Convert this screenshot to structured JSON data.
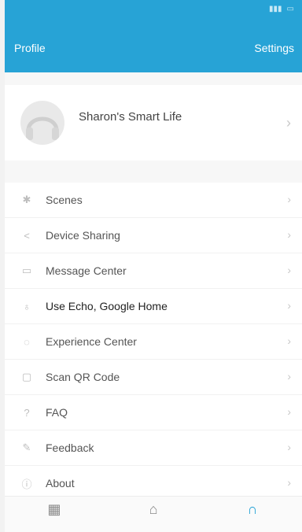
{
  "header": {
    "title": "Profile",
    "settings_label": "Settings",
    "color": "#27a3d6"
  },
  "profile": {
    "name": "Sharon's Smart Life"
  },
  "menu": {
    "items": [
      {
        "label": "Scenes",
        "icon": "scenes-icon"
      },
      {
        "label": "Device Sharing",
        "icon": "share-icon"
      },
      {
        "label": "Message Center",
        "icon": "message-icon"
      },
      {
        "label": "Use Echo, Google Home",
        "icon": "voice-assistant-icon"
      },
      {
        "label": "Experience Center",
        "icon": "experience-icon"
      },
      {
        "label": "Scan QR Code",
        "icon": "qr-code-icon"
      },
      {
        "label": "FAQ",
        "icon": "faq-icon"
      },
      {
        "label": "Feedback",
        "icon": "feedback-icon"
      },
      {
        "label": "About",
        "icon": "about-icon"
      }
    ]
  },
  "tabbar": {
    "tabs": [
      {
        "icon": "grid-icon"
      },
      {
        "icon": "smart-icon"
      },
      {
        "icon": "profile-tab-icon",
        "active": true
      }
    ]
  }
}
